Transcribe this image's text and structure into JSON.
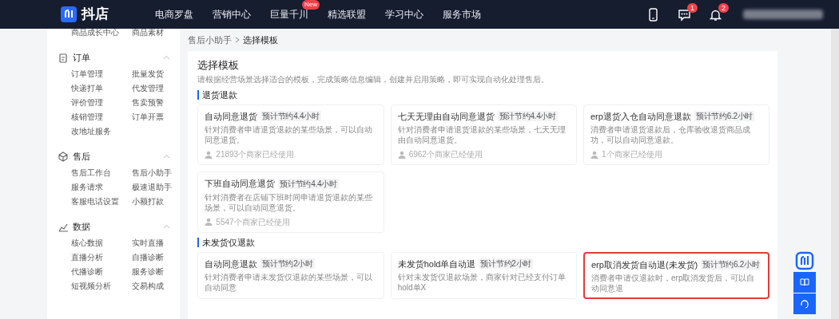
{
  "header": {
    "logo_text": "抖店",
    "nav": [
      {
        "label": "电商罗盘"
      },
      {
        "label": "营销中心"
      },
      {
        "label": "巨量千川",
        "badge": "New"
      },
      {
        "label": "精选联盟"
      },
      {
        "label": "学习中心"
      },
      {
        "label": "服务市场"
      }
    ],
    "actions": [
      {
        "kind": "phone"
      },
      {
        "kind": "message",
        "badge": "1"
      },
      {
        "kind": "bell",
        "badge": "2"
      }
    ]
  },
  "sidebar": {
    "top_items": [
      "商品成长中心",
      "商品素材"
    ],
    "sections": [
      {
        "kind": "order",
        "title": "订单",
        "expanded": true,
        "items": [
          "订单管理",
          "批量发货",
          "快递打单",
          "代发管理",
          "评价管理",
          "售卖预警",
          "核销管理",
          "订单开票",
          "改地址服务"
        ]
      },
      {
        "kind": "aftersale",
        "title": "售后",
        "expanded": true,
        "items": [
          "售后工作台",
          "售后小助手",
          "服务请求",
          "极速退助手",
          "客服电话设置",
          "小额打款"
        ]
      },
      {
        "kind": "data",
        "title": "数据",
        "expanded": true,
        "items": [
          "核心数据",
          "实时直播",
          "直播分析",
          "自播诊断",
          "代播诊断",
          "服务诊断",
          "短视频分析",
          "交易构成"
        ]
      }
    ]
  },
  "breadcrumb": [
    "售后小助手",
    "选择模板"
  ],
  "page": {
    "title": "选择模板",
    "subtitle": "请根据经营场景选择适合的模板，完成策略信息编辑，创建并启用策略，即可实现自动化处理售后。",
    "groups": [
      {
        "title": "退货退款",
        "templates": [
          {
            "title": "自动同意退货",
            "tag": "预计节约4.4小时",
            "description": "针对消费者申请退货退款的某些场景，可以自动同意退货。",
            "users": "21893个商家已经使用",
            "highlighted": false
          },
          {
            "title": "七天无理由自动同意退货",
            "tag": "预计节约4.4小时",
            "description": "针对消费者申请退货退款的某些场景，七天无理由自动同意退货。",
            "users": "6962个商家已经使用",
            "highlighted": false
          },
          {
            "title": "erp退货入仓自动同意退款",
            "tag": "预计节约6.2小时",
            "description": "消费者申请退货退款后，仓库验收退货商品成功，可以自动同意退款。",
            "users": "1个商家已经使用",
            "highlighted": false
          },
          {
            "title": "下班自动同意退货",
            "tag": "预计节约4.4小时",
            "description": "针对消费者在店铺下班时间申请退货退款的某些场景，可以自动同意退货。",
            "users": "5547个商家已经使用",
            "highlighted": false
          }
        ]
      },
      {
        "title": "未发货仅退款",
        "templates": [
          {
            "title": "自动同意退款",
            "tag": "预计节约2小时",
            "description": "针对消费者申请未发货仅退款的某些场景，可以自动同意",
            "highlighted": false
          },
          {
            "title": "未发货hold单自动退",
            "tag": "预计节约2小时",
            "description": "针对未发货仅退款场景，商家针对已经支付订单hold单X",
            "highlighted": false
          },
          {
            "title": "erp取消发货自动退(未发货)",
            "tag": "预计节约6.2小时",
            "description": "消费者申请仅退款时，erp取消发货后，可以自动同意退",
            "highlighted": true
          }
        ]
      }
    ]
  }
}
